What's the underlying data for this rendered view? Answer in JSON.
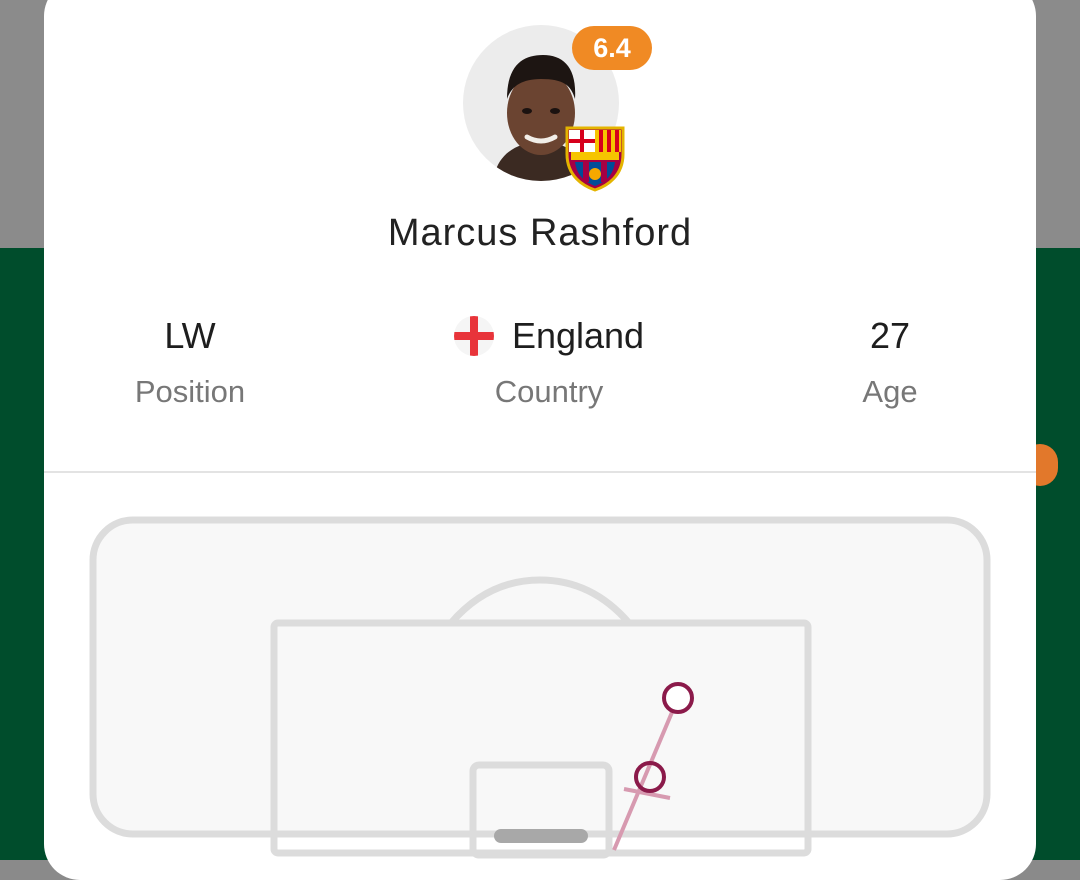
{
  "player": {
    "name": "Marcus Rashford",
    "rating": "6.4",
    "rating_color": "#f08a24",
    "club_badge_icon": "fc-barcelona-crest-icon",
    "avatar_icon": "player-photo"
  },
  "stats": {
    "position": {
      "value": "LW",
      "label": "Position"
    },
    "country": {
      "value": "England",
      "label": "Country",
      "flag_icon": "england-flag-icon"
    },
    "age": {
      "value": "27",
      "label": "Age"
    }
  },
  "shot_map": {
    "marker_color": "#8b1a4a",
    "trail_color": "#d79ab0",
    "pitch_line_color": "#dcdcdc",
    "pitch_fill": "#f8f8f8"
  },
  "colors": {
    "background_green": "#004d2c",
    "card": "#ffffff"
  }
}
